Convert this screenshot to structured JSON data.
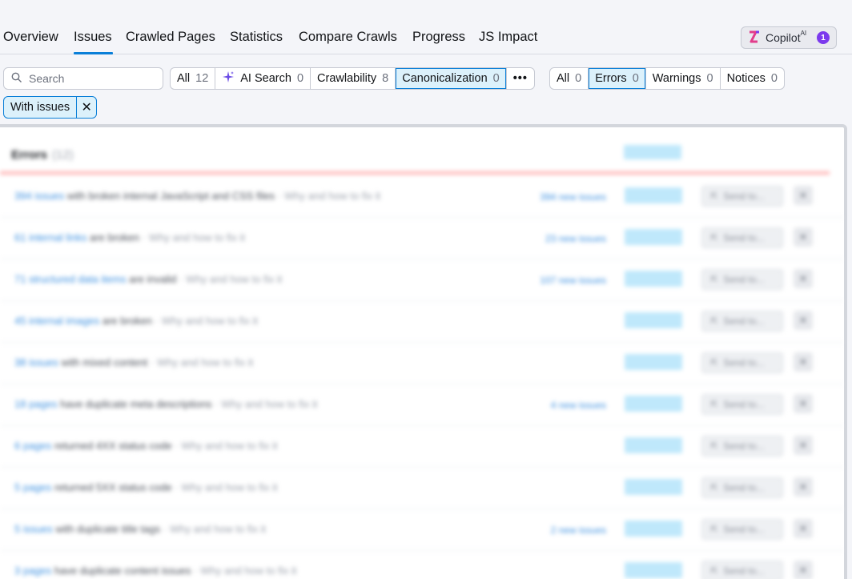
{
  "nav": {
    "tabs": [
      {
        "label": "Overview"
      },
      {
        "label": "Issues"
      },
      {
        "label": "Crawled Pages"
      },
      {
        "label": "Statistics"
      },
      {
        "label": "Compare Crawls"
      },
      {
        "label": "Progress"
      },
      {
        "label": "JS Impact"
      }
    ],
    "active_tab": "Issues",
    "copilot": {
      "label": "Copilot",
      "superscript": "AI",
      "badge": "1"
    }
  },
  "filters": {
    "search_placeholder": "Search",
    "categories": [
      {
        "label": "All",
        "count": "12"
      },
      {
        "label": "AI Search",
        "count": "0",
        "icon": "sparkle-icon"
      },
      {
        "label": "Crawlability",
        "count": "8"
      },
      {
        "label": "Canonicalization",
        "count": "0",
        "selected": true
      }
    ],
    "more_label": "•••",
    "severity": [
      {
        "label": "All",
        "count": "0"
      },
      {
        "label": "Errors",
        "count": "0",
        "selected": true
      },
      {
        "label": "Warnings",
        "count": "0"
      },
      {
        "label": "Notices",
        "count": "0"
      }
    ],
    "active_chip": "With issues"
  },
  "panel": {
    "title": "Errors",
    "count": "(12)",
    "rows": [
      {
        "link": "394 issues",
        "desc": "with broken internal JavaScript and CSS files",
        "date": "· Why and how to fix it",
        "new": "394 new issues"
      },
      {
        "link": "61 internal links",
        "desc": "are broken",
        "date": "· Why and how to fix it",
        "new": "23 new issues"
      },
      {
        "link": "71 structured data items",
        "desc": "are invalid",
        "date": "· Why and how to fix it",
        "new": "107 new issues"
      },
      {
        "link": "45 internal images",
        "desc": "are broken",
        "date": "· Why and how to fix it",
        "new": ""
      },
      {
        "link": "38 issues",
        "desc": "with mixed content",
        "date": "· Why and how to fix it",
        "new": ""
      },
      {
        "link": "18 pages",
        "desc": "have duplicate meta descriptions",
        "date": "· Why and how to fix it",
        "new": "4 new issues"
      },
      {
        "link": "6 pages",
        "desc": "returned 4XX status code",
        "date": "· Why and how to fix it",
        "new": ""
      },
      {
        "link": "5 pages",
        "desc": "returned 5XX status code",
        "date": "· Why and how to fix it",
        "new": ""
      },
      {
        "link": "5 issues",
        "desc": "with duplicate title tags",
        "date": "· Why and how to fix it",
        "new": "2 new issues"
      },
      {
        "link": "3 pages",
        "desc": "have duplicate content issues",
        "date": "· Why and how to fix it",
        "new": ""
      }
    ],
    "row_button_label": "Send to...",
    "row_close": "✕"
  }
}
